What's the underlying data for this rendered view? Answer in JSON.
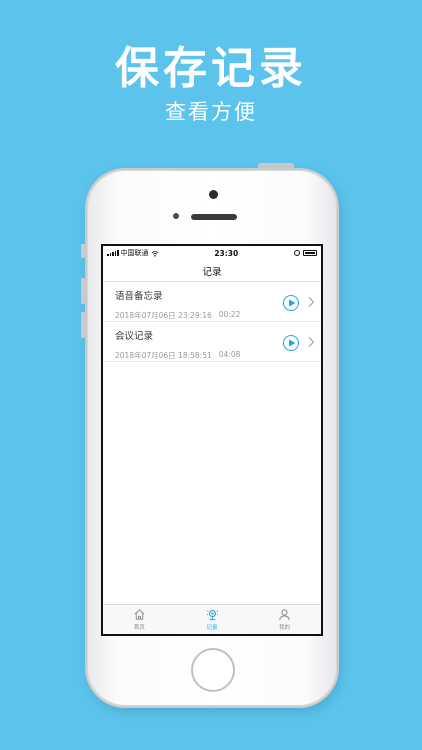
{
  "banner": {
    "headline": "保存记录",
    "subline": "查看方便"
  },
  "status_bar": {
    "carrier": "中国联通",
    "time": "23:30"
  },
  "nav": {
    "title": "记录"
  },
  "records": [
    {
      "title": "语音备忘录",
      "datetime": "2018年07月06日 23:29:16",
      "duration": "00:22"
    },
    {
      "title": "会议记录",
      "datetime": "2018年07月06日 18:58:51",
      "duration": "04:08"
    }
  ],
  "tabs": [
    {
      "label": "首页",
      "icon": "home-icon",
      "active": false
    },
    {
      "label": "记录",
      "icon": "record-icon",
      "active": true
    },
    {
      "label": "我的",
      "icon": "profile-icon",
      "active": false
    }
  ],
  "colors": {
    "background": "#5bc3ec",
    "accent": "#23a6dc"
  }
}
